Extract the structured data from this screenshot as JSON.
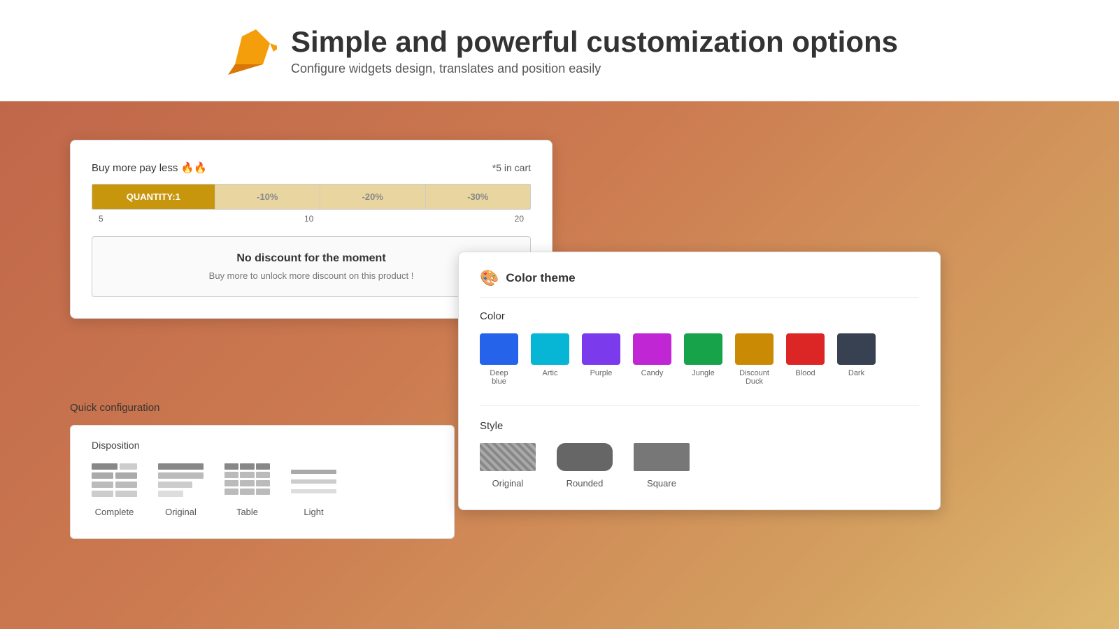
{
  "header": {
    "title": "Simple and powerful customization options",
    "subtitle": "Configure widgets design, translates and position easily"
  },
  "widget": {
    "buy_more_label": "Buy more pay less 🔥🔥",
    "in_cart_label": "*5 in cart",
    "quantity_label": "QUANTITY:1",
    "discount_10": "-10%",
    "discount_20": "-20%",
    "discount_30": "-30%",
    "label_5": "5",
    "label_10": "10",
    "label_20": "20",
    "no_discount_title": "No discount for the moment",
    "no_discount_sub": "Buy more to unlock more discount on this product !"
  },
  "quick_config": {
    "title": "Quick configuration",
    "disposition": {
      "label": "Disposition",
      "options": [
        {
          "id": "complete",
          "label": "Complete"
        },
        {
          "id": "original",
          "label": "Original"
        },
        {
          "id": "table",
          "label": "Table"
        },
        {
          "id": "light",
          "label": "Light"
        }
      ]
    }
  },
  "color_theme": {
    "title": "Color theme",
    "color_section_label": "Color",
    "style_section_label": "Style",
    "colors": [
      {
        "id": "deep-blue",
        "label": "Deep blue",
        "hex": "#2563EB"
      },
      {
        "id": "artic",
        "label": "Artic",
        "hex": "#06B6D4"
      },
      {
        "id": "purple",
        "label": "Purple",
        "hex": "#7C3AED"
      },
      {
        "id": "candy",
        "label": "Candy",
        "hex": "#C026D3"
      },
      {
        "id": "jungle",
        "label": "Jungle",
        "hex": "#16A34A"
      },
      {
        "id": "discount-duck",
        "label": "Discount Duck",
        "hex": "#CA8A04"
      },
      {
        "id": "blood",
        "label": "Blood",
        "hex": "#DC2626"
      },
      {
        "id": "dark",
        "label": "Dark",
        "hex": "#374151"
      }
    ],
    "styles": [
      {
        "id": "original",
        "label": "Original"
      },
      {
        "id": "rounded",
        "label": "Rounded"
      },
      {
        "id": "square",
        "label": "Square"
      }
    ]
  }
}
